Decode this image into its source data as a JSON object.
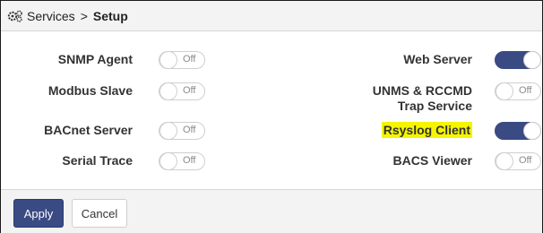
{
  "breadcrumb": {
    "icon": "gears-icon",
    "root": "Services",
    "separator": ">",
    "current": "Setup"
  },
  "left_settings": [
    {
      "label": "SNMP Agent",
      "state": "Off"
    },
    {
      "label": "Modbus Slave",
      "state": "Off"
    },
    {
      "label": "BACnet Server",
      "state": "Off"
    },
    {
      "label": "Serial Trace",
      "state": "Off"
    }
  ],
  "right_settings": [
    {
      "label": "Web Server",
      "state": "On"
    },
    {
      "label_line1": "UNMS & RCCMD",
      "label_line2": "Trap Service",
      "state": "Off"
    },
    {
      "label": "Rsyslog Client",
      "state": "On",
      "highlight": "#f5f500"
    },
    {
      "label": "BACS Viewer",
      "state": "Off"
    }
  ],
  "footer": {
    "apply_label": "Apply",
    "cancel_label": "Cancel"
  },
  "colors": {
    "accent": "#3a4a83",
    "highlight": "#f5f500"
  }
}
